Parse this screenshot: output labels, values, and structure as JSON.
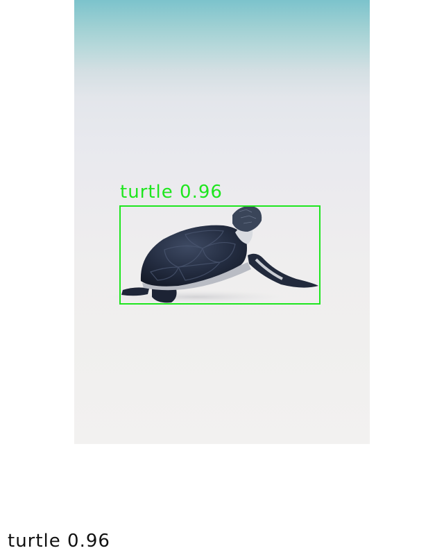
{
  "detection": {
    "label": "turtle 0.96",
    "class": "turtle",
    "confidence": 0.96,
    "box_color": "#1ee61e"
  },
  "caption": {
    "text": "turtle 0.96"
  },
  "scene": {
    "subject": "sea-turtle-hatchling",
    "background": "sandy-beach-with-sea"
  }
}
